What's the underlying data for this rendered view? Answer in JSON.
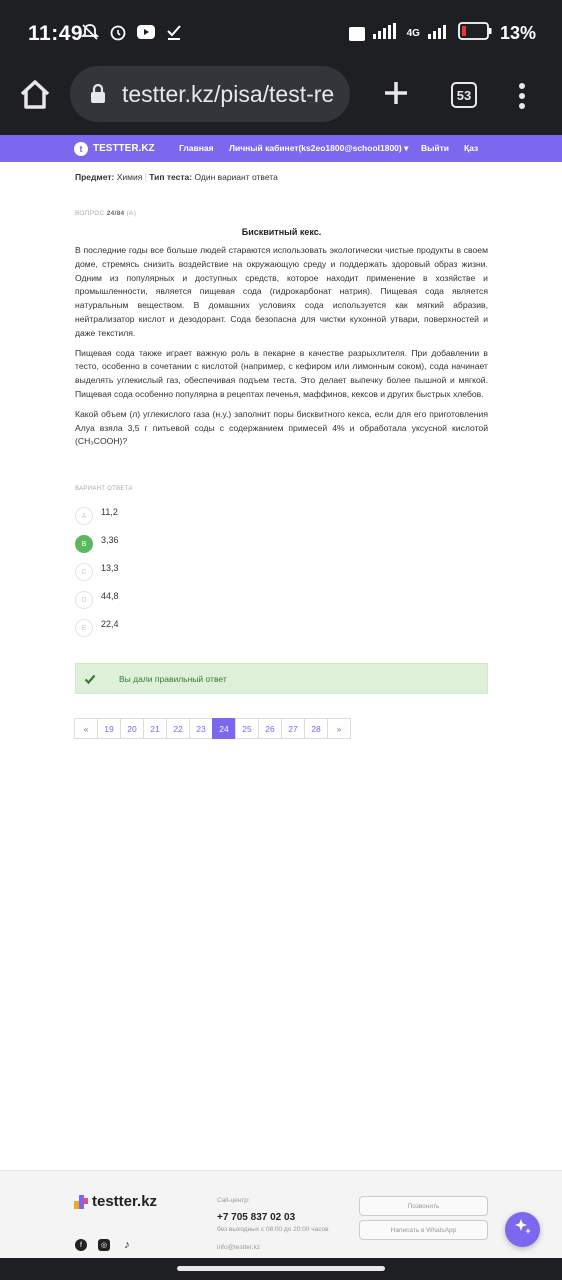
{
  "status": {
    "time": "11:49",
    "battery": "13%",
    "network": "4G"
  },
  "browser": {
    "url": "testter.kz/pisa/test-re",
    "tab_count": "53"
  },
  "navbar": {
    "brand": "TESTTER.KZ",
    "links": [
      "Главная",
      "Личный кабинет(ks2eo1800@school1800) ▾",
      "Выйти",
      "Қаз"
    ]
  },
  "meta": {
    "subject_label": "Предмет:",
    "subject": "Химия",
    "type_label": "Тип теста:",
    "type": "Один вариант ответа"
  },
  "question": {
    "number_label": "ВОПРОС",
    "number": "24/84",
    "badge": "(A)",
    "title": "Бисквитный кекс.",
    "paragraphs": [
      "В последние годы все больше людей стараются использовать экологически чистые продукты в своем доме, стремясь снизить воздействие на окружающую среду и поддержать здоровый образ жизни. Одним из популярных и доступных средств, которое находит применение в хозяйстве и промышленности, является пищевая сода (гидрокарбонат натрия). Пищевая сода является натуральным веществом. В домашних условиях сода используется как мягкий абразив, нейтрализатор кислот и дезодорант. Сода безопасна для чистки кухонной утвари, поверхностей и даже текстиля.",
      "Пищевая сода также играет важную роль в пекарне в качестве разрыхлителя. При добавлении в тесто, особенно в сочетании с кислотой (например, с кефиром или лимонным соком), сода начинает выделять углекислый газ, обеспечивая подъем теста. Это делает выпечку более пышной и мягкой. Пищевая сода особенно популярна в рецептах печенья, маффинов, кексов и других быстрых хлебов.",
      "Какой объем (л) углекислого газа (н.у.) заполнит поры бисквитного кекса, если для его приготовления Алуа взяла 3,5 г питьевой соды с содержанием примесей 4% и обработала уксусной кислотой (CH₃COOH)?"
    ]
  },
  "answers": {
    "label": "ВАРИАНТ ОТВЕТА",
    "options": [
      {
        "letter": "A",
        "text": "11,2"
      },
      {
        "letter": "B",
        "text": "3,36"
      },
      {
        "letter": "C",
        "text": "13,3"
      },
      {
        "letter": "D",
        "text": "44,8"
      },
      {
        "letter": "E",
        "text": "22,4"
      }
    ],
    "selected": "B"
  },
  "result": {
    "message": "Вы дали правильный ответ"
  },
  "pagination": {
    "prev": "«",
    "pages": [
      "19",
      "20",
      "21",
      "22",
      "23",
      "24",
      "25",
      "26",
      "27",
      "28"
    ],
    "current": "24",
    "next": "»"
  },
  "footer": {
    "logo": "testter.kz",
    "call_label": "Call-центр:",
    "phone": "+7 705 837 02 03",
    "hours": "без выходных с 08:00 до 20:00 часов",
    "email": "info@testter.kz",
    "call_button": "Позвонить",
    "whatsapp_button": "Написать в WhatsApp"
  },
  "colors": {
    "accent": "#7b68ee",
    "success_bg": "#dff0d8",
    "success_text": "#3c763d",
    "selected_option": "#5cb85c"
  }
}
